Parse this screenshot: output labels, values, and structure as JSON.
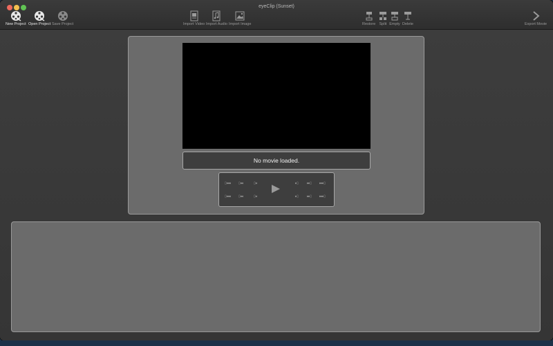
{
  "window": {
    "title": "eyeClip (Sunset)"
  },
  "toolbar": {
    "new_project": "New Project",
    "open_project": "Open Project",
    "save_project": "Save Project",
    "import_video": "Import Video",
    "import_audio": "Import Audio",
    "import_image": "Import Image",
    "restore": "Restore",
    "split": "Split",
    "empty": "Empty",
    "delete": "Delete",
    "export_movie": "Export Movie"
  },
  "preview": {
    "status": "No movie loaded."
  },
  "icons": {
    "new_project": "film-reel-icon",
    "open_project": "film-reel-icon",
    "save_project": "film-reel-icon",
    "import_video": "video-file-icon",
    "import_audio": "audio-file-icon",
    "import_image": "image-file-icon",
    "restore": "restore-icon",
    "split": "split-icon",
    "empty": "empty-icon",
    "delete": "delete-icon",
    "export_movie": "chevron-right-icon"
  },
  "colors": {
    "close": "#ed6a5e",
    "minimize": "#f5bf4f",
    "maximize": "#61c454",
    "panel": "#6b6b6b",
    "window": "#3a3a3a"
  }
}
